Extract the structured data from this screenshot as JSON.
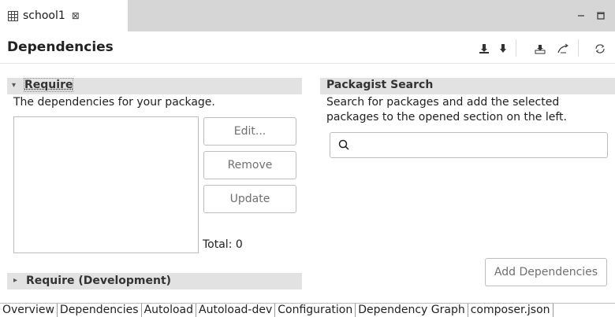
{
  "editor_tab": {
    "label": "school1",
    "close_glyph": "⊠",
    "icon": "grid-icon"
  },
  "window_controls": {
    "minimize": "−",
    "maximize": "▫"
  },
  "header": {
    "title": "Dependencies"
  },
  "toolbar_icons": [
    "install-icon",
    "update-icon",
    "self-update-icon",
    "dump-autoload-icon",
    "refresh-icon"
  ],
  "require": {
    "title": "Require",
    "description": "The dependencies for your package.",
    "buttons": {
      "edit": "Edit...",
      "remove": "Remove",
      "update": "Update"
    },
    "total": "Total: 0"
  },
  "require_dev": {
    "title": "Require (Development)"
  },
  "packagist": {
    "title": "Packagist Search",
    "description_line1": "Search for packages and add the selected",
    "description_line2": "packages to the opened section on the left.",
    "search_value": "",
    "add_button": "Add Dependencies"
  },
  "bottom_tabs": [
    {
      "label": "Overview"
    },
    {
      "label": "Dependencies",
      "active": true
    },
    {
      "label": "Autoload"
    },
    {
      "label": "Autoload-dev"
    },
    {
      "label": "Configuration"
    },
    {
      "label": "Dependency Graph"
    },
    {
      "label": "composer.json"
    }
  ],
  "colors": {
    "section_bar": "#e2e2e2",
    "tabstrip": "#d6d6d6",
    "border": "#bdbdbd",
    "disabled_text": "#707070"
  }
}
